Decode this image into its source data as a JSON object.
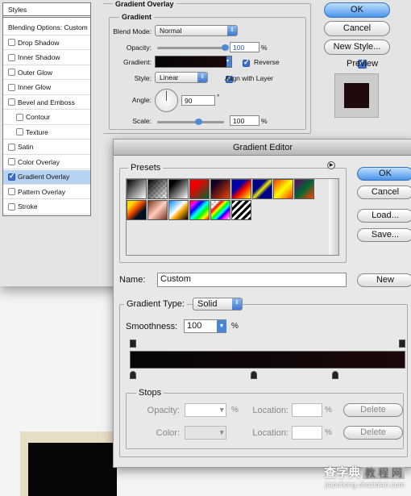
{
  "layer_style": {
    "list": [
      {
        "label": "Styles",
        "checkbox": false
      },
      {
        "label": "Blending Options: Custom",
        "checkbox": false
      },
      {
        "label": "Drop Shadow",
        "checkbox": true,
        "checked": false
      },
      {
        "label": "Inner Shadow",
        "checkbox": true,
        "checked": false
      },
      {
        "label": "Outer Glow",
        "checkbox": true,
        "checked": false
      },
      {
        "label": "Inner Glow",
        "checkbox": true,
        "checked": false
      },
      {
        "label": "Bevel and Emboss",
        "checkbox": true,
        "checked": false
      },
      {
        "label": "Contour",
        "checkbox": true,
        "checked": false,
        "indent": true
      },
      {
        "label": "Texture",
        "checkbox": true,
        "checked": false,
        "indent": true
      },
      {
        "label": "Satin",
        "checkbox": true,
        "checked": false
      },
      {
        "label": "Color Overlay",
        "checkbox": true,
        "checked": false
      },
      {
        "label": "Gradient Overlay",
        "checkbox": true,
        "checked": true,
        "selected": true
      },
      {
        "label": "Pattern Overlay",
        "checkbox": true,
        "checked": false
      },
      {
        "label": "Stroke",
        "checkbox": true,
        "checked": false
      }
    ],
    "section_title": "Gradient Overlay",
    "group_title": "Gradient",
    "blend_mode_label": "Blend Mode:",
    "blend_mode": "Normal",
    "opacity_label": "Opacity:",
    "opacity": "100",
    "opacity_pct": 100,
    "pct": "%",
    "gradient_label": "Gradient:",
    "reverse_label": "Reverse",
    "reverse": true,
    "style_label": "Style:",
    "style": "Linear",
    "align_label": "Align with Layer",
    "align": true,
    "angle_label": "Angle:",
    "angle": "90",
    "deg": "°",
    "scale_label": "Scale:",
    "scale": "100",
    "scale_pct": 100,
    "ok": "OK",
    "cancel": "Cancel",
    "new_style": "New Style...",
    "preview_label": "Preview",
    "preview": true
  },
  "gradient_editor": {
    "title": "Gradient Editor",
    "presets_label": "Presets",
    "ok": "OK",
    "cancel": "Cancel",
    "load": "Load...",
    "save": "Save...",
    "name_label": "Name:",
    "name": "Custom",
    "new": "New",
    "type_label": "Gradient Type:",
    "type": "Solid",
    "smoothness_label": "Smoothness:",
    "smoothness": "100",
    "pct": "%",
    "color_stop_locations": [
      0,
      45,
      75
    ],
    "opacity_stop_locations": [
      0,
      100
    ],
    "stops_label": "Stops",
    "opacity_label": "Opacity:",
    "color_label": "Color:",
    "location_label": "Location:",
    "delete": "Delete"
  },
  "colors": {
    "gradient_start": "#050508",
    "gradient_end": "#1c0808",
    "selection": "#b7d3f4",
    "accent": "#4a95ea"
  },
  "watermark": {
    "text1": "查字典",
    "text2": "教 程 网",
    "url": "jiaocheng.chazidian.com"
  }
}
